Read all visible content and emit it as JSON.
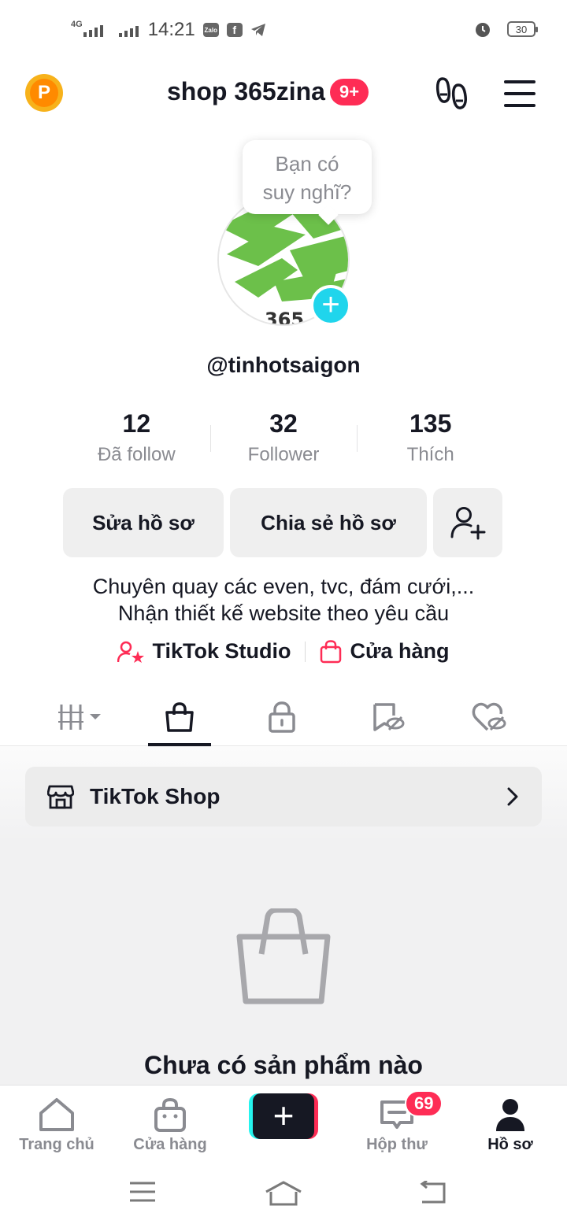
{
  "status_bar": {
    "network_label": "4G",
    "time": "14:21",
    "apps": [
      "Zalo",
      "f"
    ],
    "battery": "30"
  },
  "header": {
    "title": "shop 365zina",
    "badge": "9+"
  },
  "profile": {
    "bubble_text_1": "Bạn có",
    "bubble_text_2": "suy nghĩ?",
    "avatar_text": "365",
    "username": "@tinhotsaigon",
    "stats": [
      {
        "value": "12",
        "label": "Đã follow"
      },
      {
        "value": "32",
        "label": "Follower"
      },
      {
        "value": "135",
        "label": "Thích"
      }
    ],
    "edit_button": "Sửa hồ sơ",
    "share_button": "Chia sẻ hồ sơ",
    "bio_line_1": "Chuyên quay các even, tvc, đám cưới,...",
    "bio_line_2": "Nhận thiết kế website theo yêu cầu",
    "link_studio": "TikTok Studio",
    "link_shop": "Cửa hàng"
  },
  "tabs": [
    "videos",
    "shop",
    "private",
    "reposts",
    "liked"
  ],
  "active_tab": "shop",
  "content": {
    "shop_card_label": "TikTok Shop",
    "empty_text": "Chưa có sản phẩm nào"
  },
  "bottom_nav": {
    "home": "Trang chủ",
    "store": "Cửa hàng",
    "create": "+",
    "inbox": "Hộp thư",
    "inbox_badge": "69",
    "profile": "Hồ sơ"
  },
  "colors": {
    "accent": "#fe2c55",
    "cyan": "#25f4ee",
    "text": "#161823",
    "muted": "#8a8b91"
  }
}
